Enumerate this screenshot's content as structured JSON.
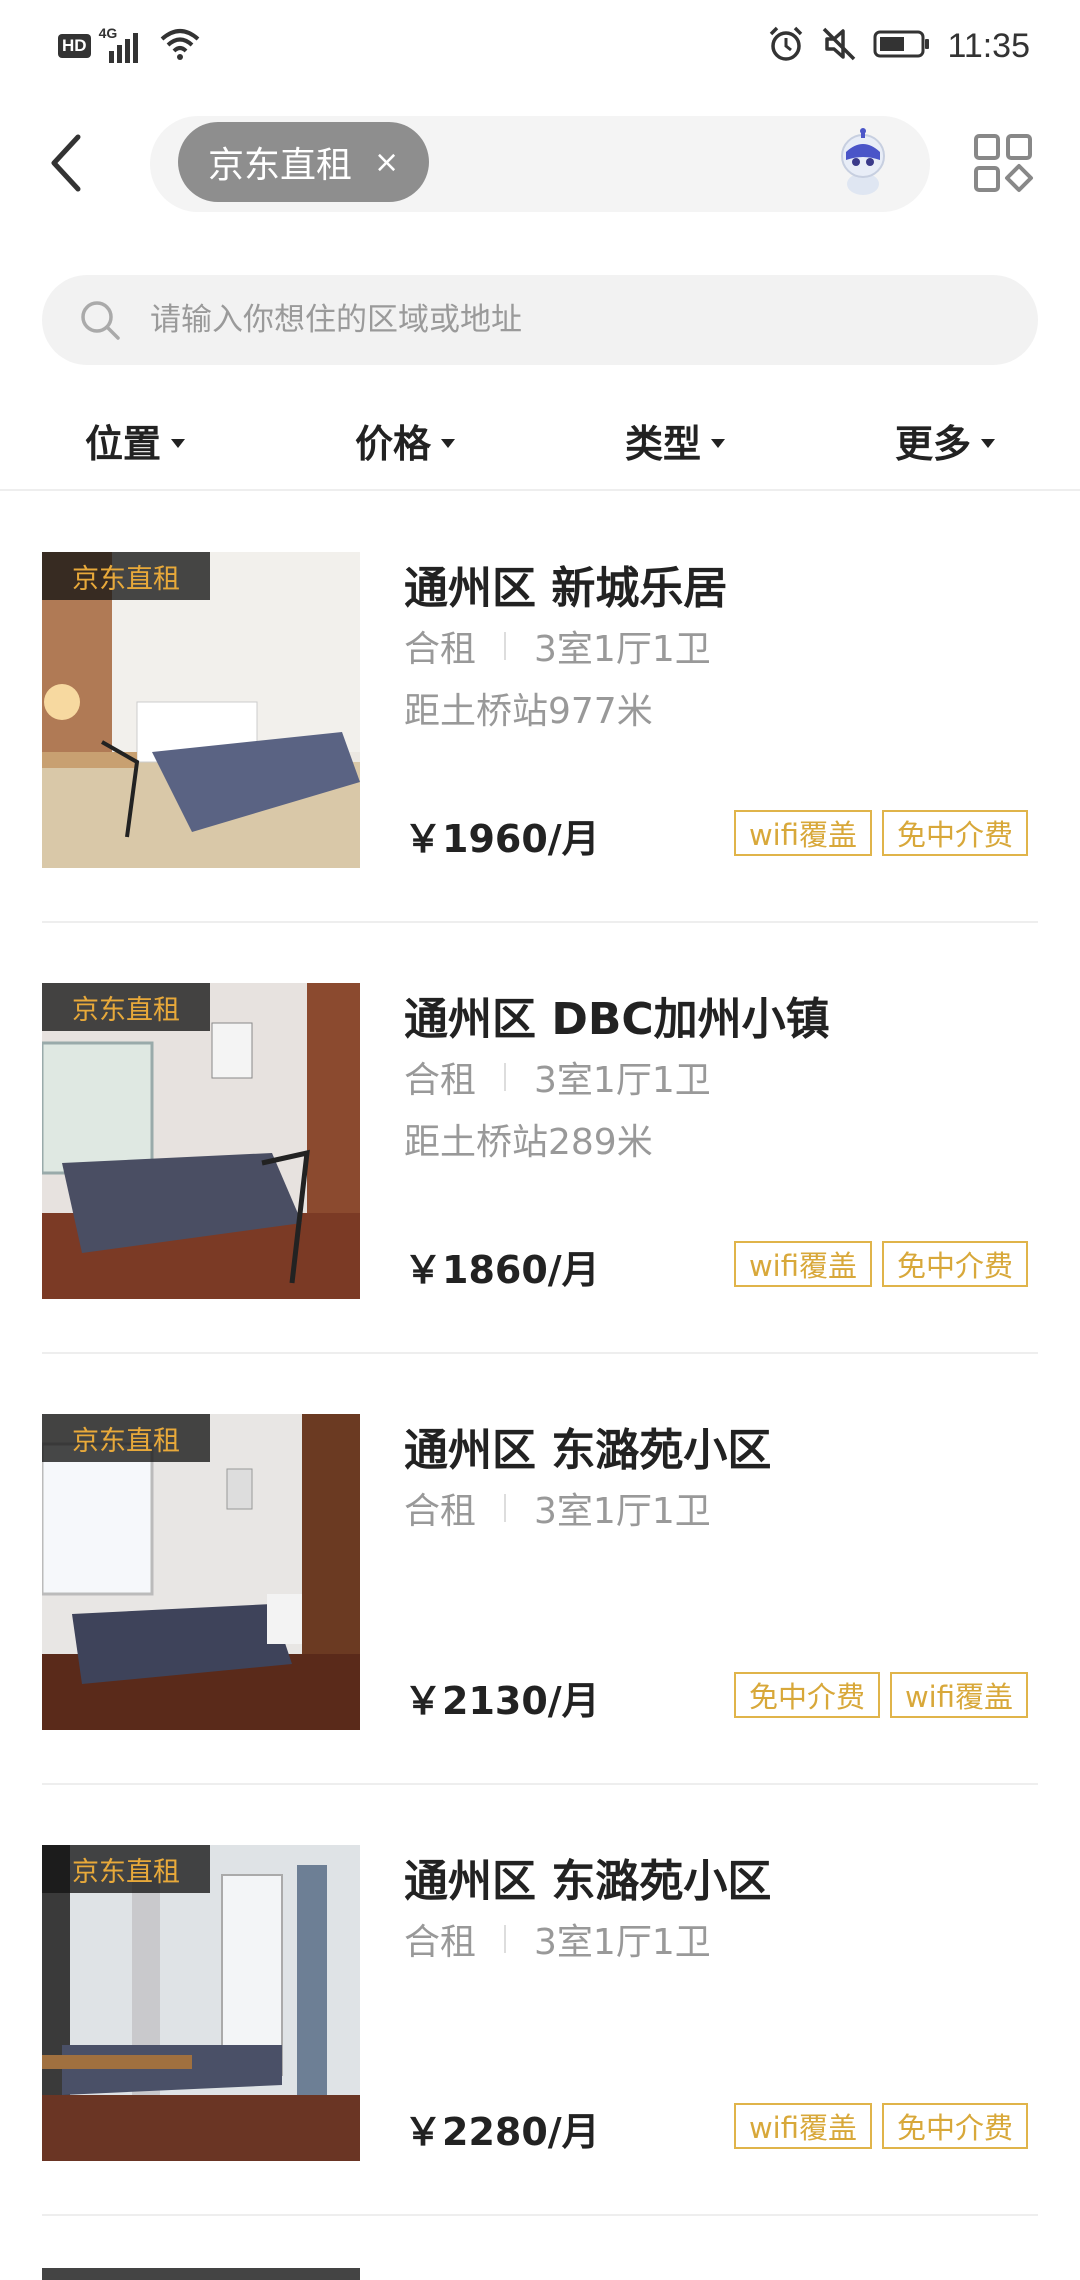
{
  "status_bar": {
    "hd": "HD",
    "network": "4G",
    "time": "11:35"
  },
  "header": {
    "chip_label": "京东直租",
    "chip_close": "×"
  },
  "search": {
    "placeholder": "请输入你想住的区域或地址"
  },
  "filters": [
    {
      "label": "位置"
    },
    {
      "label": "价格"
    },
    {
      "label": "类型"
    },
    {
      "label": "更多"
    }
  ],
  "listings": [
    {
      "badge": "京东直租",
      "title": "通州区 新城乐居",
      "type": "合租",
      "layout": "3室1厅1卫",
      "distance": "距土桥站977米",
      "price": "￥1960/月",
      "tags": [
        "wifi覆盖",
        "免中介费"
      ]
    },
    {
      "badge": "京东直租",
      "title": "通州区 DBC加州小镇",
      "type": "合租",
      "layout": "3室1厅1卫",
      "distance": "距土桥站289米",
      "price": "￥1860/月",
      "tags": [
        "wifi覆盖",
        "免中介费"
      ]
    },
    {
      "badge": "京东直租",
      "title": "通州区 东潞苑小区",
      "type": "合租",
      "layout": "3室1厅1卫",
      "distance": "",
      "price": "￥2130/月",
      "tags": [
        "免中介费",
        "wifi覆盖"
      ]
    },
    {
      "badge": "京东直租",
      "title": "通州区 东潞苑小区",
      "type": "合租",
      "layout": "3室1厅1卫",
      "distance": "",
      "price": "￥2280/月",
      "tags": [
        "wifi覆盖",
        "免中介费"
      ]
    }
  ],
  "colors": {
    "badge_text": "#e8a93a",
    "tag_border": "#e0b44a",
    "chip_bg": "#8e8e8e"
  },
  "icons": {
    "back": "chevron-left-icon",
    "search": "search-icon",
    "grid": "grid-icon",
    "assistant": "robot-assistant-icon"
  }
}
